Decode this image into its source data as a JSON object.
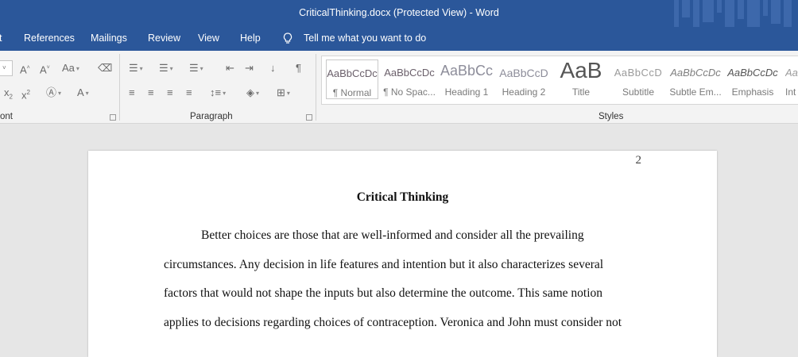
{
  "window": {
    "title": "CriticalThinking.docx (Protected View)  -  Word"
  },
  "menu": {
    "items": [
      "t",
      "References",
      "Mailings",
      "Review",
      "View",
      "Help"
    ],
    "tell_me": "Tell me what you want to do"
  },
  "ribbon": {
    "groups": {
      "font": "ont",
      "paragraph": "Paragraph",
      "styles": "Styles"
    },
    "styles": [
      {
        "sample": "AaBbCcDc",
        "name": "¶ Normal"
      },
      {
        "sample": "AaBbCcDc",
        "name": "¶ No Spac..."
      },
      {
        "sample": "AaBbCc",
        "name": "Heading 1"
      },
      {
        "sample": "AaBbCcD",
        "name": "Heading 2"
      },
      {
        "sample": "AaB",
        "name": "Title"
      },
      {
        "sample": "AaBbCcD",
        "name": "Subtitle"
      },
      {
        "sample": "AaBbCcDc",
        "name": "Subtle Em..."
      },
      {
        "sample": "AaBbCcDc",
        "name": "Emphasis"
      },
      {
        "sample": "Aa",
        "name": "Int"
      }
    ]
  },
  "document": {
    "page_number": "2",
    "title": "Critical Thinking",
    "lines": [
      "Better choices are those that are well-informed and consider all the prevailing",
      "circumstances. Any decision in life features and intention but it also characterizes several",
      "factors that would not shape the inputs but also determine the outcome. This same notion",
      "applies to decisions regarding choices of contraception. Veronica and John must consider not"
    ]
  },
  "colors": {
    "titlebar": "#2b579a",
    "ribbon": "#f3f3f3",
    "canvas": "#e6e6e6",
    "page": "#ffffff"
  }
}
